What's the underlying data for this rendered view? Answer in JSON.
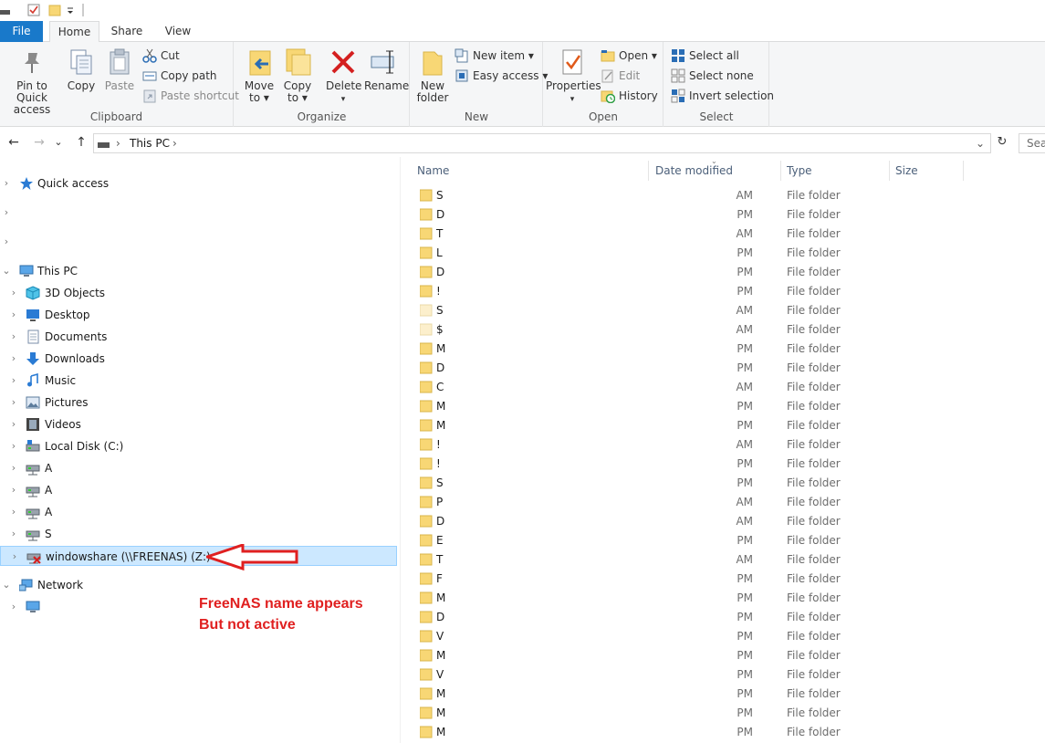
{
  "ribbon_tabs": [
    "File",
    "Home",
    "Share",
    "View"
  ],
  "clipboard": {
    "pin_label": "Pin to Quick access",
    "pin_line1": "Pin to Quick",
    "pin_line2": "access",
    "copy_label": "Copy",
    "paste_label": "Paste",
    "cut_label": "Cut",
    "copy_path_label": "Copy path",
    "paste_shortcut_label": "Paste shortcut",
    "group_label": "Clipboard"
  },
  "organize": {
    "move_to_line1": "Move",
    "move_to_line2": "to ▾",
    "copy_to_line1": "Copy",
    "copy_to_line2": "to ▾",
    "delete_label": "Delete",
    "delete_arrow": "▾",
    "rename_label": "Rename",
    "group_label": "Organize"
  },
  "new": {
    "new_folder_line1": "New",
    "new_folder_line2": "folder",
    "new_item_label": "New item ▾",
    "easy_access_label": "Easy access ▾",
    "group_label": "New"
  },
  "open": {
    "properties_label": "Properties",
    "properties_arrow": "▾",
    "open_label": "Open ▾",
    "edit_label": "Edit",
    "history_label": "History",
    "group_label": "Open"
  },
  "select": {
    "select_all_label": "Select all",
    "select_none_label": "Select none",
    "invert_selection_label": "Invert selection",
    "group_label": "Select"
  },
  "address": {
    "back_icon": "←",
    "forward_icon": "→",
    "recent_icon": "⌄",
    "up_icon": "↑",
    "sep1": "›",
    "location": "This PC",
    "sep2": "›",
    "dropdown_icon": "⌄",
    "refresh_icon": "↻",
    "search_placeholder": "Search This PC"
  },
  "nav": {
    "quick_access": "Quick access",
    "this_pc": "This PC",
    "items": [
      {
        "label": "3D Objects",
        "icon": "3d-objects-icon"
      },
      {
        "label": "Desktop",
        "icon": "desktop-icon"
      },
      {
        "label": "Documents",
        "icon": "documents-icon"
      },
      {
        "label": "Downloads",
        "icon": "downloads-icon"
      },
      {
        "label": "Music",
        "icon": "music-icon"
      },
      {
        "label": "Pictures",
        "icon": "pictures-icon"
      },
      {
        "label": "Videos",
        "icon": "videos-icon"
      },
      {
        "label": "Local Disk (C:)",
        "icon": "local-disk-icon"
      },
      {
        "label": "A",
        "icon": "network-drive-icon"
      },
      {
        "label": "A",
        "icon": "network-drive-icon"
      },
      {
        "label": "A",
        "icon": "network-drive-icon"
      },
      {
        "label": "S",
        "icon": "network-drive-icon"
      },
      {
        "label": "windowshare (\\\\FREENAS) (Z:)",
        "icon": "disconnected-drive-icon"
      }
    ],
    "network": "Network"
  },
  "annotation": {
    "line1": "FreeNAS name appears",
    "line2": "But not active",
    "arrow_color": "#e02020"
  },
  "columns": [
    "Name",
    "Date modified",
    "Type",
    "Size"
  ],
  "files": [
    {
      "name": "S",
      "date": "AM",
      "type": "File folder"
    },
    {
      "name": "D",
      "date": "PM",
      "type": "File folder"
    },
    {
      "name": "T",
      "date": "AM",
      "type": "File folder"
    },
    {
      "name": "L",
      "date": "PM",
      "type": "File folder"
    },
    {
      "name": "D",
      "date": "PM",
      "type": "File folder"
    },
    {
      "name": "!",
      "date": "PM",
      "type": "File folder"
    },
    {
      "name": "S",
      "date": "AM",
      "type": "File folder"
    },
    {
      "name": "$",
      "date": "AM",
      "type": "File folder"
    },
    {
      "name": "M",
      "date": "PM",
      "type": "File folder"
    },
    {
      "name": "D",
      "date": "PM",
      "type": "File folder"
    },
    {
      "name": "C",
      "date": "AM",
      "type": "File folder"
    },
    {
      "name": "M",
      "date": "PM",
      "type": "File folder"
    },
    {
      "name": "M",
      "date": "PM",
      "type": "File folder"
    },
    {
      "name": "!",
      "date": "AM",
      "type": "File folder"
    },
    {
      "name": "!",
      "date": "PM",
      "type": "File folder"
    },
    {
      "name": "S",
      "date": "PM",
      "type": "File folder"
    },
    {
      "name": "P",
      "date": "AM",
      "type": "File folder"
    },
    {
      "name": "D",
      "date": "AM",
      "type": "File folder"
    },
    {
      "name": "E",
      "date": "PM",
      "type": "File folder"
    },
    {
      "name": "T",
      "date": "AM",
      "type": "File folder"
    },
    {
      "name": "F",
      "date": "PM",
      "type": "File folder"
    },
    {
      "name": "M",
      "date": "PM",
      "type": "File folder"
    },
    {
      "name": "D",
      "date": "PM",
      "type": "File folder"
    },
    {
      "name": "V",
      "date": "PM",
      "type": "File folder"
    },
    {
      "name": "M",
      "date": "PM",
      "type": "File folder"
    },
    {
      "name": "V",
      "date": "PM",
      "type": "File folder"
    },
    {
      "name": "M",
      "date": "PM",
      "type": "File folder"
    },
    {
      "name": "M",
      "date": "PM",
      "type": "File folder"
    },
    {
      "name": "M",
      "date": "PM",
      "type": "File folder"
    }
  ],
  "colors": {
    "file_tab": "#1979ca",
    "selection": "#cce8ff",
    "folder": "#f8d775",
    "delete_red": "#d42020",
    "annotation_red": "#e02020"
  }
}
